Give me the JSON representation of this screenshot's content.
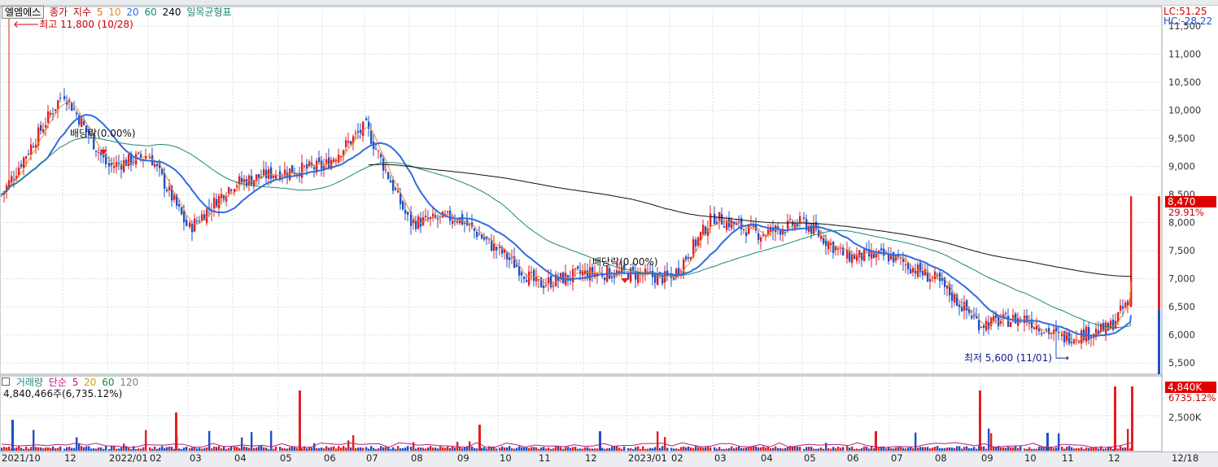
{
  "header": {
    "stock_name": "엘엠에스",
    "price_label": "종가",
    "ma_label": "지수",
    "ma_periods": [
      {
        "label": "5",
        "color": "#e07000"
      },
      {
        "label": "10",
        "color": "#f08a30"
      },
      {
        "label": "20",
        "color": "#2f6ce0"
      },
      {
        "label": "60",
        "color": "#1a8a7a"
      },
      {
        "label": "240",
        "color": "#000000"
      }
    ],
    "ichimoku_label": "일목균형표"
  },
  "right_info": {
    "lc": "LC:51.25",
    "hc": "HC:-28.22"
  },
  "current_price": {
    "value": "8,470",
    "change": "29.91%"
  },
  "annotations": {
    "high": "최고 11,800 (10/28)",
    "low": "최저 5,600 (11/01)",
    "dividend1": "배당락(0.00%)",
    "dividend2": "배당락(0.00%)"
  },
  "volume_header": {
    "label": "거래량",
    "simple_label": "단순",
    "periods": [
      {
        "label": "5",
        "color": "#c01880"
      },
      {
        "label": "20",
        "color": "#d0a000"
      },
      {
        "label": "60",
        "color": "#1a8a2a"
      },
      {
        "label": "120",
        "color": "#808080"
      }
    ],
    "current": "4,840,466주(6,735.12%)"
  },
  "volume_right": {
    "value": "4,840K",
    "pct": "6735.12%",
    "tick": "2,500K"
  },
  "chart_data": {
    "type": "candlestick",
    "title": "엘엠에스",
    "x_labels": [
      "2021/10",
      "12",
      "2022/01",
      "02",
      "03",
      "04",
      "05",
      "06",
      "07",
      "08",
      "09",
      "10",
      "11",
      "12",
      "2023/01",
      "02",
      "03",
      "04",
      "05",
      "06",
      "07",
      "08",
      "09",
      "10",
      "11",
      "12",
      "12/18"
    ],
    "y_ticks": [
      5500,
      6000,
      6500,
      7000,
      7500,
      8000,
      8500,
      9000,
      9500,
      10000,
      10500,
      11000,
      11500
    ],
    "ylim": [
      5300,
      11850
    ],
    "series_trend": [
      {
        "label": "2021/10",
        "close": 8500
      },
      {
        "label": "11",
        "close": 10300
      },
      {
        "label": "12",
        "close": 9000
      },
      {
        "label": "2022/01",
        "close": 9200
      },
      {
        "label": "02",
        "close": 7900
      },
      {
        "label": "03",
        "close": 8700
      },
      {
        "label": "04",
        "close": 8900
      },
      {
        "label": "05",
        "close": 9000
      },
      {
        "label": "06",
        "close": 9700
      },
      {
        "label": "07",
        "close": 8000
      },
      {
        "label": "08",
        "close": 8100
      },
      {
        "label": "09",
        "close": 7500
      },
      {
        "label": "10",
        "close": 6900
      },
      {
        "label": "11",
        "close": 7100
      },
      {
        "label": "12",
        "close": 7100
      },
      {
        "label": "2023/01",
        "close": 7000
      },
      {
        "label": "02",
        "close": 8100
      },
      {
        "label": "03",
        "close": 7800
      },
      {
        "label": "04",
        "close": 8000
      },
      {
        "label": "05",
        "close": 7400
      },
      {
        "label": "06",
        "close": 7400
      },
      {
        "label": "07",
        "close": 7000
      },
      {
        "label": "08",
        "close": 6200
      },
      {
        "label": "09",
        "close": 6300
      },
      {
        "label": "10",
        "close": 5950
      },
      {
        "label": "11",
        "close": 6100
      },
      {
        "label": "12",
        "close": 6700
      },
      {
        "label": "12/18",
        "close": 8470
      }
    ],
    "high_value": 11800,
    "low_value": 5600,
    "last_close": 8470,
    "last_change_pct": 29.91,
    "volume_yticks": [
      2500
    ],
    "volume_last": 4840466
  }
}
